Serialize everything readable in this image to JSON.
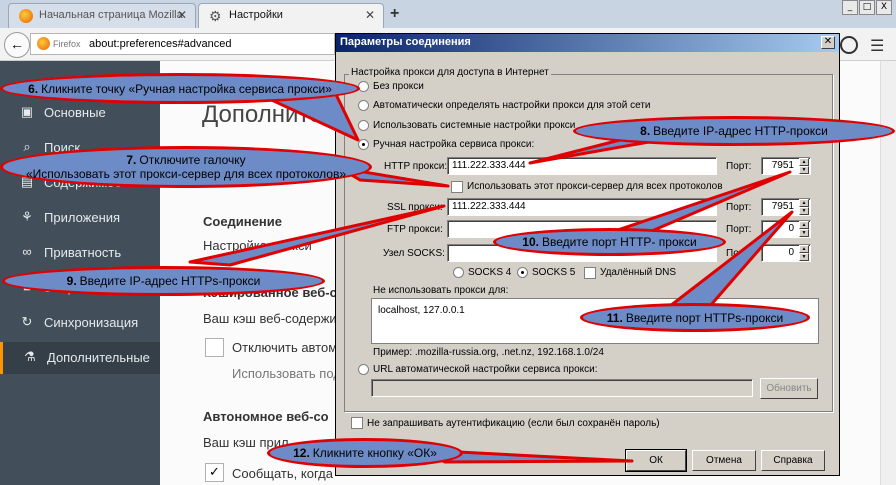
{
  "browser": {
    "tabs": [
      {
        "label": "Начальная страница Mozilla ..."
      },
      {
        "label": "Настройки"
      }
    ],
    "new_tab": "+",
    "window_buttons": [
      "_",
      "□",
      "X"
    ],
    "brand": "Firefox",
    "url": "about:preferences#advanced"
  },
  "sidebar": {
    "items": [
      {
        "label": "Основные",
        "icon": "home-icon"
      },
      {
        "label": "Поиск",
        "icon": "search-icon"
      },
      {
        "label": "Содержимое",
        "icon": "content-icon"
      },
      {
        "label": "Приложения",
        "icon": "apps-icon"
      },
      {
        "label": "Приватность",
        "icon": "mask-icon"
      },
      {
        "label": "Защита",
        "icon": "lock-icon"
      },
      {
        "label": "Синхронизация",
        "icon": "sync-icon"
      },
      {
        "label": "Дополнительные",
        "icon": "flask-icon"
      }
    ]
  },
  "content": {
    "heading": "Дополнител",
    "connection_title": "Соединение",
    "connection_text": "Настройка прокси",
    "cache_title": "Кэшированное веб-с",
    "cache_text": "Ваш кэш веб-содержим",
    "override_label": "Отключить автом",
    "use_label": "Использовать под",
    "offline_title": "Автономное веб-со",
    "offline_text": "Ваш кэш прил",
    "notify_label": "Сообщать, когда"
  },
  "dialog": {
    "title": "Параметры соединения",
    "group_label": "Настройка прокси для доступа в Интернет",
    "radios": {
      "no_proxy": "Без прокси",
      "auto_detect": "Автоматически определять настройки прокси для этой сети",
      "system": "Использовать системные настройки прокси",
      "manual": "Ручная настройка сервиса прокси:",
      "auto_url": "URL автоматической настройки сервиса прокси:"
    },
    "http": {
      "label": "HTTP прокси:",
      "value": "111.222.333.444",
      "port_label": "Порт:",
      "port": "7951"
    },
    "share_label": "Использовать этот прокси-сервер для всех протоколов",
    "ssl": {
      "label": "SSL прокси:",
      "value": "111.222.333.444",
      "port_label": "Порт:",
      "port": "7951"
    },
    "ftp": {
      "label": "FTP прокси:",
      "value": "",
      "port_label": "Порт:",
      "port": "0"
    },
    "socks": {
      "label": "Узел SOCKS:",
      "value": "",
      "port_label": "Порт:",
      "port": "0"
    },
    "socks4": "SOCKS 4",
    "socks5": "SOCKS 5",
    "remote_dns": "Удалённый DNS",
    "no_proxy_label": "Не использовать прокси для:",
    "no_proxy_value": "localhost, 127.0.0.1",
    "example": "Пример: .mozilla-russia.org, .net.nz, 192.168.1.0/24",
    "reload": "Обновить",
    "no_auth": "Не запрашивать аутентификацию (если был сохранён пароль)",
    "ok": "ОК",
    "cancel": "Отмена",
    "help": "Справка"
  },
  "callouts": {
    "c6": {
      "num": "6.",
      "text": "Кликните точку «Ручная настройка сервиса прокси»"
    },
    "c7": {
      "num": "7.",
      "text": "Отключите галочку"
    },
    "c7b": "«Использовать этот прокси-сервер для всех протоколов»",
    "c8": {
      "num": "8.",
      "text": "Введите IP-адрес HTTP-прокси"
    },
    "c9": {
      "num": "9.",
      "text": "Введите IP-адрес HTTPs-прокси"
    },
    "c10": {
      "num": "10.",
      "text": "Введите порт HTTP- прокси"
    },
    "c11": {
      "num": "11.",
      "text": "Введите порт HTTPs-прокси"
    },
    "c12": {
      "num": "12.",
      "text": "Кликните кнопку «ОК»"
    }
  },
  "colors": {
    "callout_fill": "#6d8bc6",
    "callout_border": "#e00000",
    "dialog_title": "#0a246a",
    "sidebar": "#424f5a",
    "accent": "#ff9500"
  }
}
